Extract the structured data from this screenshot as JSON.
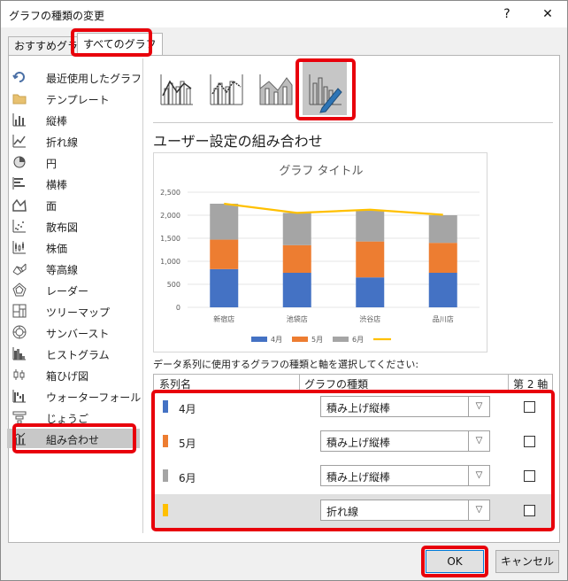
{
  "window": {
    "title": "グラフの種類の変更",
    "help_label": "?",
    "close_label": "✕"
  },
  "tabs": [
    {
      "label": "おすすめグラフ"
    },
    {
      "label": "すべてのグラフ"
    }
  ],
  "sidebar": {
    "items": [
      {
        "label": "最近使用したグラフ",
        "icon": "recent-icon"
      },
      {
        "label": "テンプレート",
        "icon": "folder-icon"
      },
      {
        "label": "縦棒",
        "icon": "column-chart-icon"
      },
      {
        "label": "折れ線",
        "icon": "line-chart-icon"
      },
      {
        "label": "円",
        "icon": "pie-chart-icon"
      },
      {
        "label": "横棒",
        "icon": "bar-chart-icon"
      },
      {
        "label": "面",
        "icon": "area-chart-icon"
      },
      {
        "label": "散布図",
        "icon": "scatter-chart-icon"
      },
      {
        "label": "株価",
        "icon": "stock-chart-icon"
      },
      {
        "label": "等高線",
        "icon": "surface-chart-icon"
      },
      {
        "label": "レーダー",
        "icon": "radar-chart-icon"
      },
      {
        "label": "ツリーマップ",
        "icon": "treemap-chart-icon"
      },
      {
        "label": "サンバースト",
        "icon": "sunburst-chart-icon"
      },
      {
        "label": "ヒストグラム",
        "icon": "histogram-chart-icon"
      },
      {
        "label": "箱ひげ図",
        "icon": "boxwhisker-chart-icon"
      },
      {
        "label": "ウォーターフォール",
        "icon": "waterfall-chart-icon"
      },
      {
        "label": "じょうご",
        "icon": "funnel-chart-icon"
      },
      {
        "label": "組み合わせ",
        "icon": "combo-chart-icon",
        "selected": true
      }
    ]
  },
  "combo_types": [
    {
      "icon": "clustered-column-line-icon"
    },
    {
      "icon": "clustered-column-line-secondary-icon"
    },
    {
      "icon": "stacked-area-clustered-column-icon"
    },
    {
      "icon": "custom-combination-icon",
      "selected": true
    }
  ],
  "section": {
    "title": "ユーザー設定の組み合わせ"
  },
  "chart_data": {
    "type": "bar",
    "title": "グラフ タイトル",
    "categories": [
      "新宿店",
      "池袋店",
      "渋谷店",
      "品川店"
    ],
    "series": [
      {
        "name": "4月",
        "type": "stacked-bar",
        "color": "#4472c4",
        "values": [
          830,
          750,
          650,
          750
        ]
      },
      {
        "name": "5月",
        "type": "stacked-bar",
        "color": "#ed7d31",
        "values": [
          640,
          600,
          780,
          650
        ]
      },
      {
        "name": "6月",
        "type": "stacked-bar",
        "color": "#a5a5a5",
        "values": [
          780,
          700,
          680,
          600
        ]
      },
      {
        "name": "",
        "type": "line",
        "color": "#ffc000",
        "values": [
          2250,
          2050,
          2120,
          2010
        ]
      }
    ],
    "yticks": [
      "0",
      "500",
      "1,000",
      "1,500",
      "2,000",
      "2,500"
    ],
    "ylim": [
      0,
      2500
    ],
    "grid": true,
    "legend": "bottom"
  },
  "series_panel": {
    "prompt": "データ系列に使用するグラフの種類と軸を選択してください:",
    "headers": {
      "name": "系列名",
      "type": "グラフの種類",
      "axis": "第 2 軸"
    },
    "rows": [
      {
        "name": "4月",
        "color": "#4472c4",
        "type": "積み上げ縦棒",
        "secondary": false
      },
      {
        "name": "5月",
        "color": "#ed7d31",
        "type": "積み上げ縦棒",
        "secondary": false
      },
      {
        "name": "6月",
        "color": "#a5a5a5",
        "type": "積み上げ縦棒",
        "secondary": false
      },
      {
        "name": "",
        "color": "#ffc000",
        "type": "折れ線",
        "secondary": false,
        "selected": true
      }
    ]
  },
  "buttons": {
    "ok": "OK",
    "cancel": "キャンセル"
  }
}
